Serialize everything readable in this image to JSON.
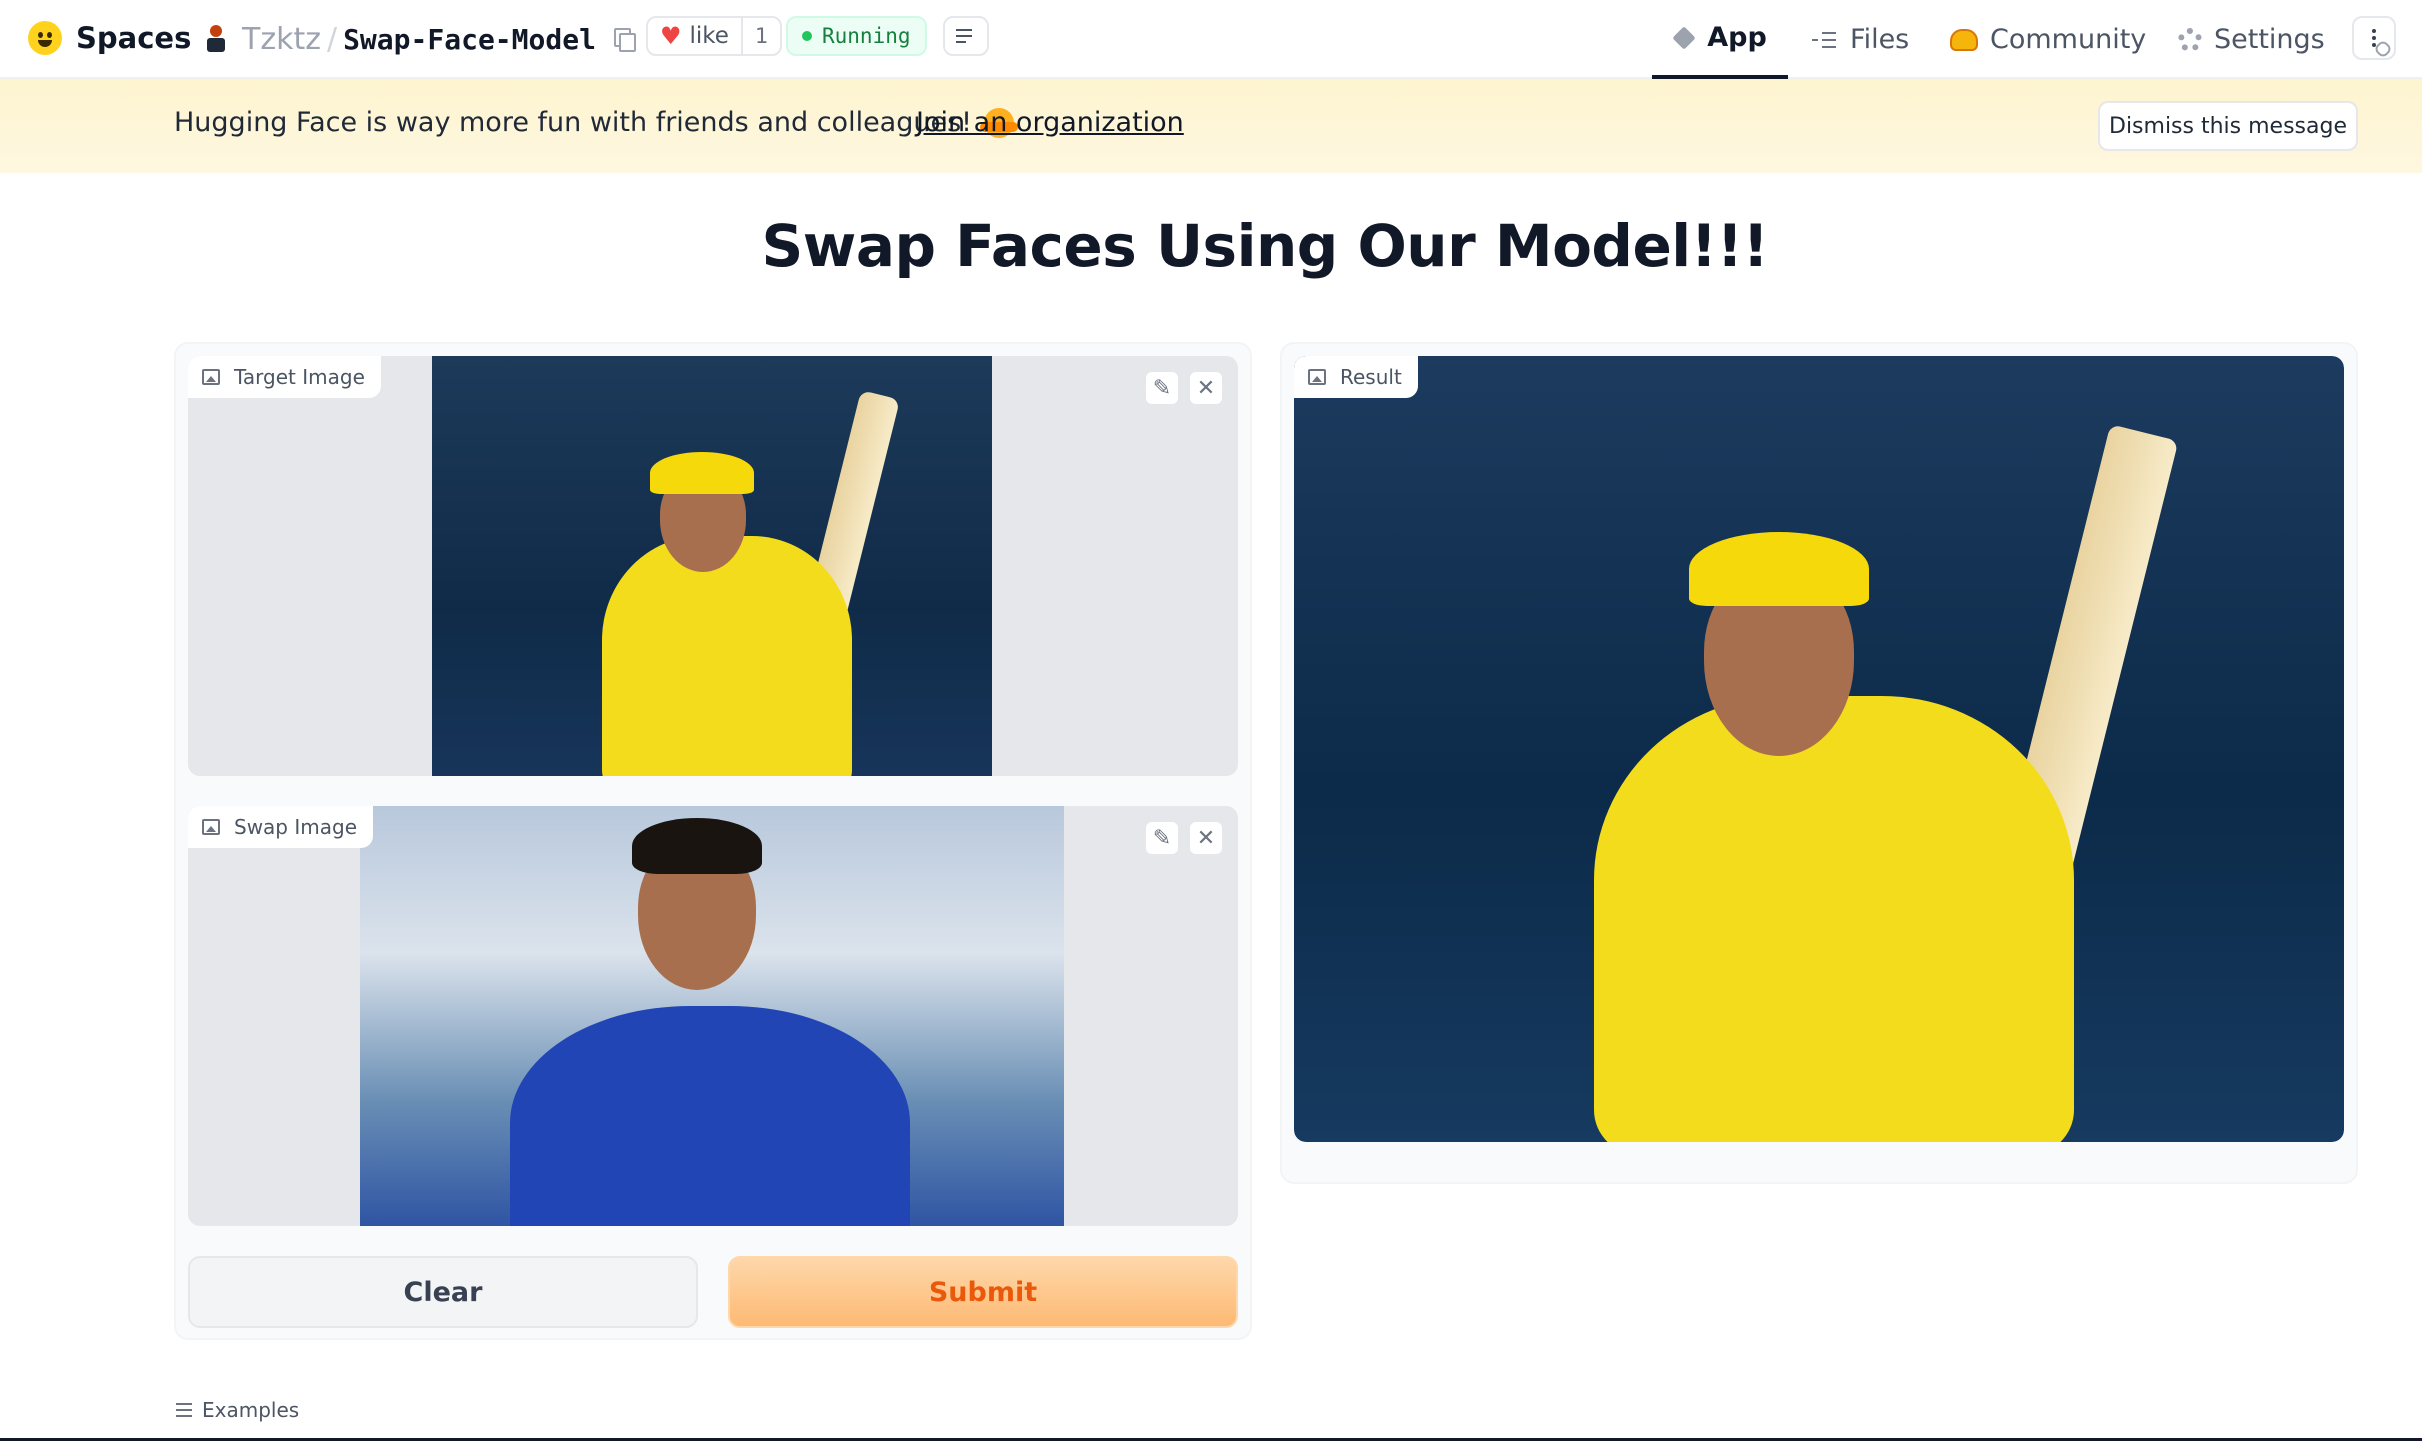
{
  "header": {
    "brand": "Spaces",
    "owner": "Tzktz",
    "separator": "/",
    "space_name": "Swap-Face-Model",
    "like_label": "like",
    "like_count": "1",
    "status": "Running",
    "nav": {
      "app": "App",
      "files": "Files",
      "community": "Community",
      "settings": "Settings"
    }
  },
  "banner": {
    "message": "Hugging Face is way more fun with friends and colleagues!",
    "link": "Join an organization",
    "dismiss": "Dismiss this message"
  },
  "main": {
    "title": "Swap Faces Using Our Model!!!",
    "target_label": "Target Image",
    "swap_label": "Swap Image",
    "result_label": "Result",
    "clear_label": "Clear",
    "submit_label": "Submit",
    "examples_label": "Examples"
  },
  "icons": {
    "edit": "pencil-icon",
    "close": "close-icon",
    "image": "image-icon"
  },
  "colors": {
    "accent": "#ea580c",
    "submit_bg": "#fdba74",
    "running": "#15803d",
    "banner_bg": "#fdf4cf"
  }
}
